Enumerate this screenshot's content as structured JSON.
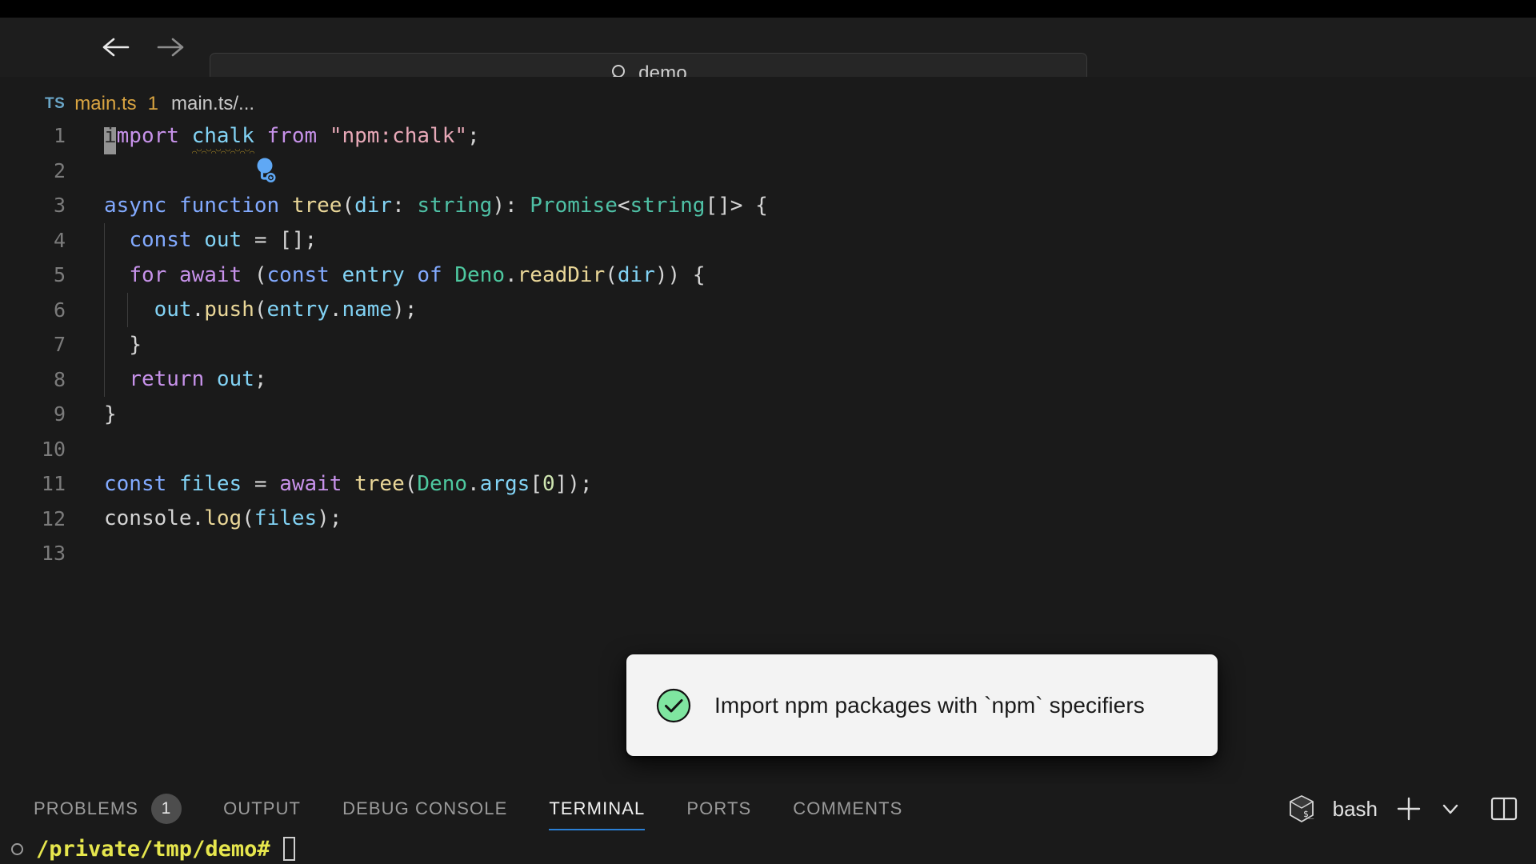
{
  "window": {
    "command_bar": {
      "value": "demo",
      "search_icon": "search-icon",
      "back_label": "Back",
      "forward_label": "Forward"
    }
  },
  "breadcrumb": {
    "lang_badge": "TS",
    "file": "main.ts",
    "problem_count": "1",
    "path": "main.ts/..."
  },
  "editor": {
    "language": "typescript",
    "cursor_line": 1,
    "cursor_column": 2,
    "lines": [
      {
        "n": "1",
        "text": "import chalk from \"npm:chalk\";"
      },
      {
        "n": "2",
        "text": ""
      },
      {
        "n": "3",
        "text": "async function tree(dir: string): Promise<string[]> {"
      },
      {
        "n": "4",
        "text": "  const out = [];"
      },
      {
        "n": "5",
        "text": "  for await (const entry of Deno.readDir(dir)) {"
      },
      {
        "n": "6",
        "text": "    out.push(entry.name);"
      },
      {
        "n": "7",
        "text": "  }"
      },
      {
        "n": "8",
        "text": "  return out;"
      },
      {
        "n": "9",
        "text": "}"
      },
      {
        "n": "10",
        "text": ""
      },
      {
        "n": "11",
        "text": "const files = await tree(Deno.args[0]);"
      },
      {
        "n": "12",
        "text": "console.log(files);"
      },
      {
        "n": "13",
        "text": ""
      }
    ],
    "tokens": {
      "l1": [
        "i",
        "mport",
        " ",
        "chalk",
        " ",
        "from",
        " ",
        "\"npm:chalk\"",
        ";"
      ],
      "l3": [
        "async",
        " ",
        "function",
        " ",
        "tree",
        "(",
        "dir",
        ":",
        " ",
        "string",
        ")",
        ":",
        " ",
        "Promise",
        "<",
        "string",
        "[]>",
        " ",
        "{"
      ],
      "l4": [
        "const",
        " ",
        "out",
        " ",
        "=",
        " ",
        "[];"
      ],
      "l5": [
        "for",
        " ",
        "await",
        " ",
        "(",
        "const",
        " ",
        "entry",
        " ",
        "of",
        " ",
        "Deno",
        ".",
        "readDir",
        "(",
        "dir",
        ")) ",
        "{"
      ],
      "l6": [
        "out",
        ".",
        "push",
        "(",
        "entry",
        ".",
        "name",
        ");"
      ],
      "l7": [
        "}"
      ],
      "l8": [
        "return",
        " ",
        "out",
        ";"
      ],
      "l9": [
        "}"
      ],
      "l11": [
        "const",
        " ",
        "files",
        " ",
        "=",
        " ",
        "await",
        " ",
        "tree",
        "(",
        "Deno",
        ".",
        "args",
        "[",
        "0",
        "]);"
      ],
      "l12": [
        "console",
        ".",
        "log",
        "(",
        "files",
        ");"
      ]
    },
    "diagnostic": {
      "squiggle_word": "chalk",
      "squiggle_color": "#c9a227",
      "lightbulb_icon": "quick-fix-lightbulb-icon"
    }
  },
  "toast": {
    "icon": "success-check-icon",
    "icon_color": "#7fe5a0",
    "message": "Import npm packages with `npm` specifiers"
  },
  "panel": {
    "tabs": [
      {
        "id": "problems",
        "label": "PROBLEMS",
        "badge": "1",
        "active": false
      },
      {
        "id": "output",
        "label": "OUTPUT",
        "badge": "",
        "active": false
      },
      {
        "id": "debug-console",
        "label": "DEBUG CONSOLE",
        "badge": "",
        "active": false
      },
      {
        "id": "terminal",
        "label": "TERMINAL",
        "badge": "",
        "active": true
      },
      {
        "id": "ports",
        "label": "PORTS",
        "badge": "",
        "active": false
      },
      {
        "id": "comments",
        "label": "COMMENTS",
        "badge": "",
        "active": false
      }
    ],
    "active_tab_underline_color": "#2b7fd4",
    "shell": {
      "icon": "terminal-cube-icon",
      "name": "bash",
      "new_terminal_icon": "plus-icon",
      "dropdown_icon": "chevron-down-icon",
      "split_icon": "split-editor-icon"
    },
    "terminal": {
      "prompt": "/private/tmp/demo#",
      "prompt_color": "#e6e64d",
      "status_icon": "circle-icon",
      "cursor": "block-cursor"
    }
  }
}
